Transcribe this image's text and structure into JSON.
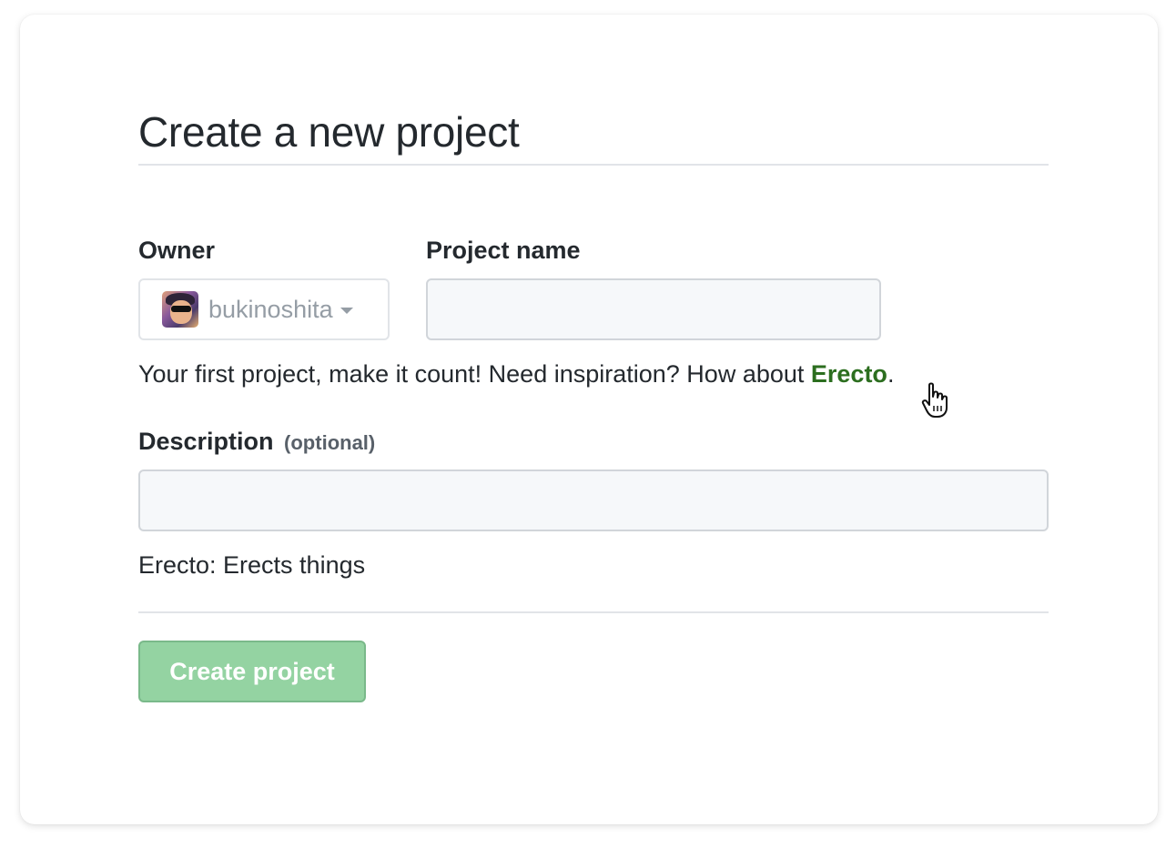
{
  "page": {
    "title": "Create a new project"
  },
  "form": {
    "owner_label": "Owner",
    "owner_value": "bukinoshita",
    "project_name_label": "Project name",
    "project_name_value": "",
    "hint_prefix": "Your first project, make it count! Need inspiration? How about ",
    "hint_suggestion": "Erecto",
    "hint_suffix": ".",
    "description_label": "Description",
    "description_optional": "(optional)",
    "description_value": "",
    "description_echo": "Erecto: Erects things",
    "submit_label": "Create project"
  },
  "icons": {
    "owner_dropdown": "caret-down-icon",
    "cursor": "hand-pointer-icon"
  },
  "colors": {
    "suggestion_link": "#2c6e1f",
    "submit_button_bg": "#94d3a2",
    "text": "#24292e"
  }
}
